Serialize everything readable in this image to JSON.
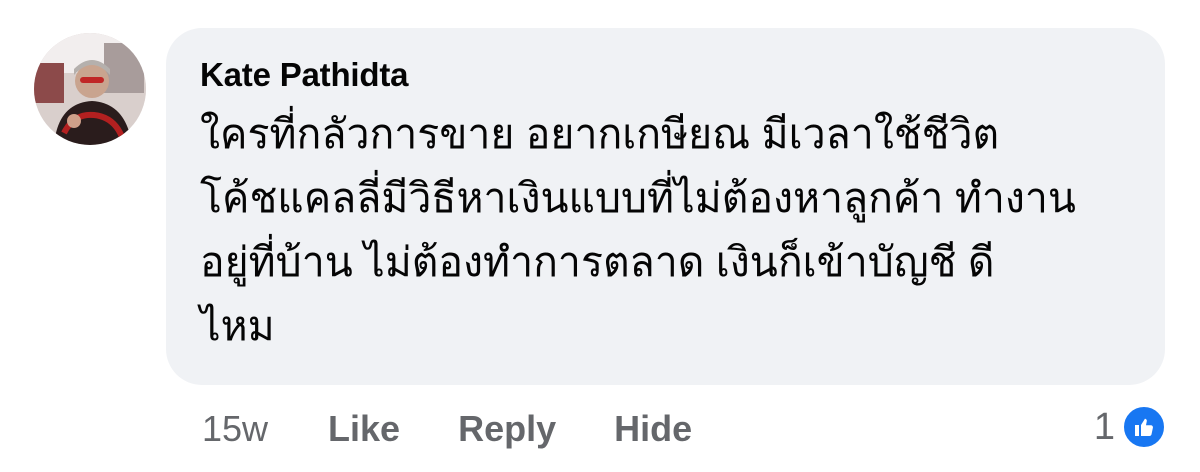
{
  "comment": {
    "author": "Kate Pathidta",
    "text": "ใครที่กลัวการขาย อยากเกษียณ มีเวลาใช้ชีวิต\nโค้ชแคลลี่มีวิธีหาเงินแบบที่ไม่ต้องหาลูกค้า ทำงาน\nอยู่ที่บ้าน ไม่ต้องทำการตลาด เงินก็เข้าบัญชี ดี\nไหม",
    "avatar_icon": "user-photo"
  },
  "actions": {
    "time": "15w",
    "like_label": "Like",
    "reply_label": "Reply",
    "hide_label": "Hide"
  },
  "reactions": {
    "count": "1",
    "icon": "thumbs-up-icon",
    "color": "#1877f2"
  }
}
